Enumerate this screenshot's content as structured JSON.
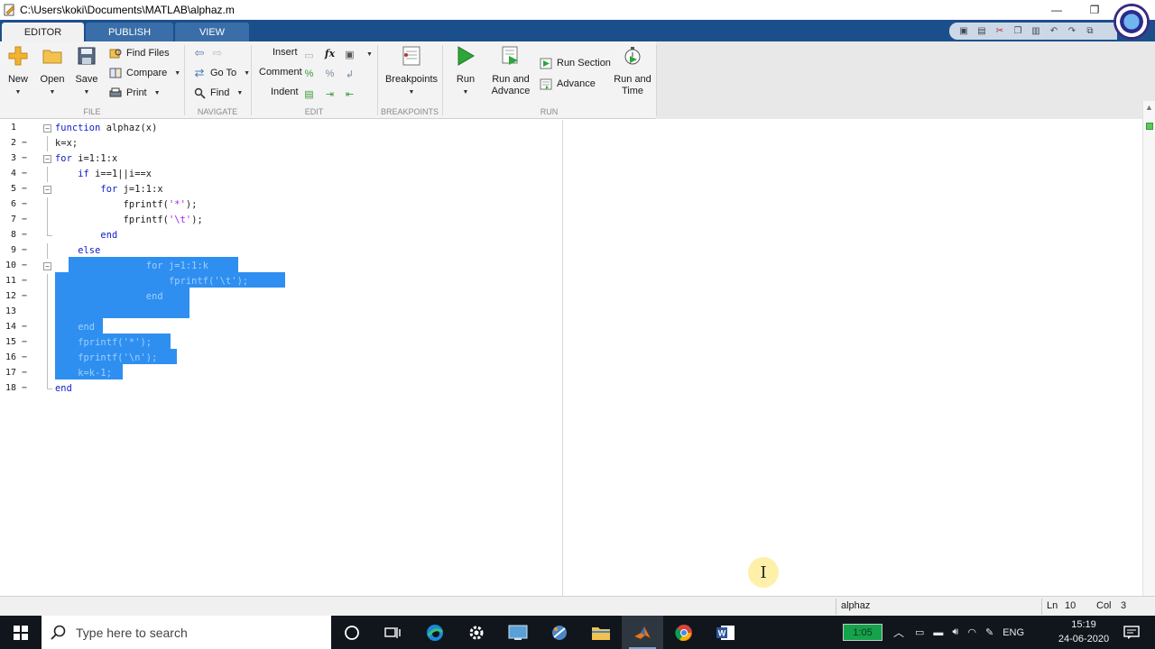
{
  "window": {
    "title": "C:\\Users\\koki\\Documents\\MATLAB\\alphaz.m"
  },
  "tabs": [
    {
      "label": "EDITOR",
      "active": true
    },
    {
      "label": "PUBLISH",
      "active": false
    },
    {
      "label": "VIEW",
      "active": false
    }
  ],
  "toolstrip": {
    "file": {
      "group_label": "FILE",
      "new_label": "New",
      "open_label": "Open",
      "save_label": "Save",
      "find_files_label": "Find Files",
      "compare_label": "Compare",
      "print_label": "Print"
    },
    "navigate": {
      "group_label": "NAVIGATE",
      "go_to_label": "Go To",
      "find_label": "Find"
    },
    "edit": {
      "group_label": "EDIT",
      "insert_label": "Insert",
      "comment_label": "Comment",
      "indent_label": "Indent",
      "fx_symbol": "fx"
    },
    "breakpoints": {
      "group_label": "BREAKPOINTS",
      "breakpoints_label": "Breakpoints"
    },
    "run": {
      "group_label": "RUN",
      "run_label": "Run",
      "run_and_advance_line1": "Run and",
      "run_and_advance_line2": "Advance",
      "run_section_label": "Run Section",
      "advance_label": "Advance",
      "run_and_time_line1": "Run and",
      "run_and_time_line2": "Time"
    }
  },
  "editor": {
    "lines": [
      {
        "n": "1",
        "code": "function alphaz(x)"
      },
      {
        "n": "2",
        "code": "k=x;"
      },
      {
        "n": "3",
        "code": "for i=1:1:x"
      },
      {
        "n": "4",
        "code": "    if i==1||i==x"
      },
      {
        "n": "5",
        "code": "        for j=1:1:x"
      },
      {
        "n": "6",
        "code": "            fprintf('*');"
      },
      {
        "n": "7",
        "code": "            fprintf('\\t');"
      },
      {
        "n": "8",
        "code": "        end"
      },
      {
        "n": "9",
        "code": "    else"
      },
      {
        "n": "10",
        "code": "                for j=1:1:k"
      },
      {
        "n": "11",
        "code": "                    fprintf('\\t');"
      },
      {
        "n": "12",
        "code": "                end"
      },
      {
        "n": "13",
        "code": ""
      },
      {
        "n": "14",
        "code": "    end"
      },
      {
        "n": "15",
        "code": "    fprintf('*');"
      },
      {
        "n": "16",
        "code": "    fprintf('\\n');"
      },
      {
        "n": "17",
        "code": "    k=k-1;"
      },
      {
        "n": "18",
        "code": "end"
      }
    ]
  },
  "statusbar": {
    "file_name": "alphaz",
    "ln_label": "Ln",
    "ln_value": "10",
    "col_label": "Col",
    "col_value": "3"
  },
  "taskbar": {
    "search_placeholder": "Type here to search",
    "battery_text": "1:05",
    "language": "ENG",
    "time": "15:19",
    "date": "24-06-2020"
  }
}
